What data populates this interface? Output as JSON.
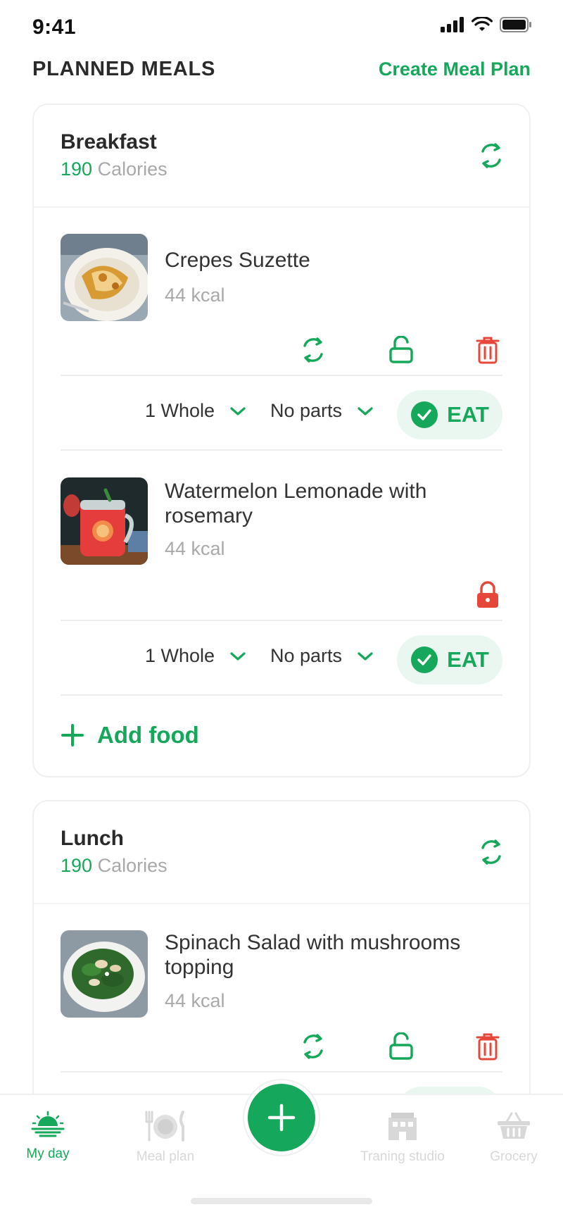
{
  "status_bar": {
    "time": "9:41"
  },
  "header": {
    "title": "PLANNED MEALS",
    "create_label": "Create Meal Plan"
  },
  "meals": [
    {
      "name": "Breakfast",
      "calories_value": "190",
      "calories_unit": "Calories",
      "foods": [
        {
          "name": "Crepes Suzette",
          "kcal": "44 kcal",
          "locked": false,
          "portion": "1 Whole",
          "parts": "No parts",
          "eat_label": "EAT"
        },
        {
          "name": "Watermelon Lemonade with rosemary",
          "kcal": "44 kcal",
          "locked": true,
          "portion": "1 Whole",
          "parts": "No parts",
          "eat_label": "EAT"
        }
      ],
      "add_food_label": "Add food"
    },
    {
      "name": "Lunch",
      "calories_value": "190",
      "calories_unit": "Calories",
      "foods": [
        {
          "name": "Spinach Salad with mushrooms topping",
          "kcal": "44 kcal",
          "locked": false
        }
      ]
    }
  ],
  "bottom_nav": {
    "items": [
      {
        "label": "My day",
        "icon": "sunrise-icon",
        "active": true
      },
      {
        "label": "Meal plan",
        "icon": "plate-cutlery-icon",
        "active": false
      },
      {
        "label": "Traning studio",
        "icon": "building-icon",
        "active": false
      },
      {
        "label": "Grocery",
        "icon": "basket-icon",
        "active": false
      }
    ],
    "fab_icon": "plus-icon"
  },
  "colors": {
    "accent": "#16a85a",
    "danger": "#e5483b",
    "muted": "#a9a9a9",
    "eat_bg": "#eaf7f0"
  }
}
